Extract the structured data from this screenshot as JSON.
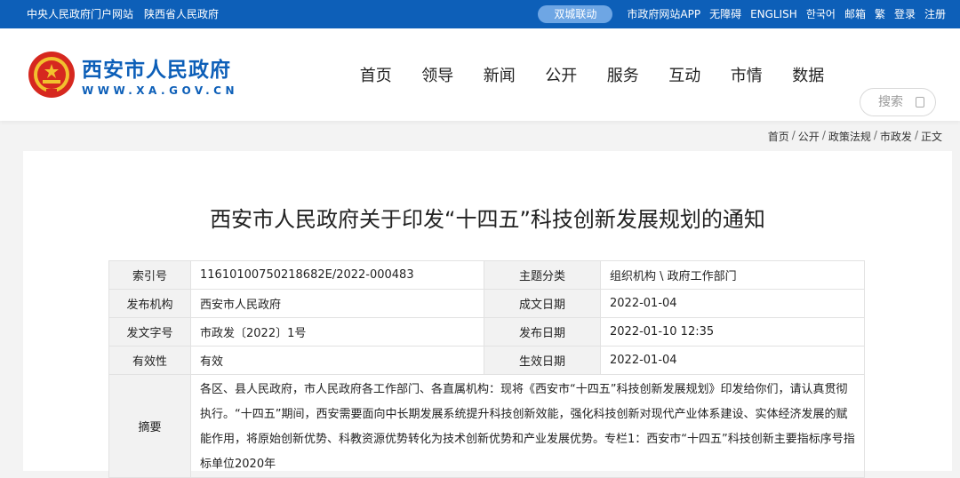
{
  "topbar": {
    "left_links": [
      "中央人民政府门户网站",
      "陕西省人民政府"
    ],
    "pill": "双城联动",
    "right_links": [
      "市政府网站APP",
      "无障碍",
      "ENGLISH",
      "한국어",
      "邮箱",
      "繁",
      "登录",
      "注册"
    ]
  },
  "logo": {
    "name_cn": "西安市人民政府",
    "domain": "WWW.XA.GOV.CN"
  },
  "nav": [
    "首页",
    "领导",
    "新闻",
    "公开",
    "服务",
    "互动",
    "市情",
    "数据"
  ],
  "search": {
    "placeholder": "搜索"
  },
  "breadcrumb": [
    "首页",
    "公开",
    "政策法规",
    "市政发",
    "正文"
  ],
  "article": {
    "title": "西安市人民政府关于印发“十四五”科技创新发展规划的通知",
    "info": [
      {
        "label1": "索引号",
        "value1": "11610100750218682E/2022-000483",
        "label2": "主题分类",
        "value2": "组织机构 \\ 政府工作部门"
      },
      {
        "label1": "发布机构",
        "value1": "西安市人民政府",
        "label2": "成文日期",
        "value2": "2022-01-04"
      },
      {
        "label1": "发文字号",
        "value1": "市政发〔2022〕1号",
        "label2": "发布日期",
        "value2": "2022-01-10 12:35"
      },
      {
        "label1": "有效性",
        "value1": "有效",
        "label2": "生效日期",
        "value2": "2022-01-04"
      }
    ],
    "abstract_label": "摘要",
    "abstract": "各区、县人民政府，市人民政府各工作部门、各直属机构：现将《西安市“十四五”科技创新发展规划》印发给你们，请认真贯彻执行。“十四五”期间，西安需要面向中长期发展系统提升科技创新效能，强化科技创新对现代产业体系建设、实体经济发展的赋能作用，将原始创新优势、科教资源优势转化为技术创新优势和产业发展优势。专栏1：西安市“十四五”科技创新主要指标序号指标单位2020年"
  }
}
